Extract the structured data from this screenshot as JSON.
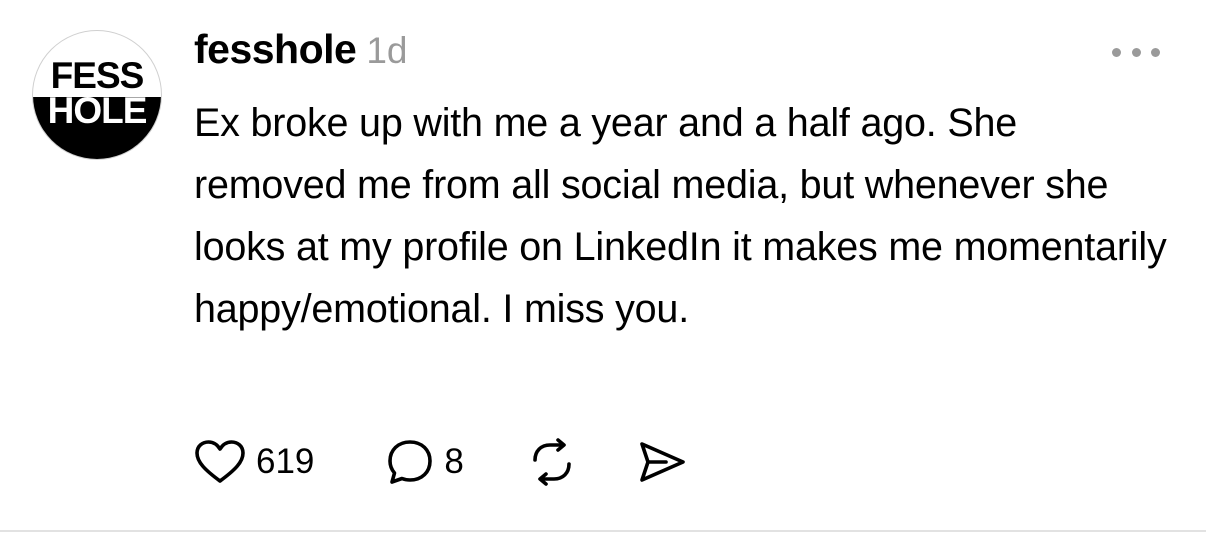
{
  "post": {
    "avatar": {
      "line1": "FESS",
      "line2": "HOLE"
    },
    "username": "fesshole",
    "timestamp": "1d",
    "more_icon": "ellipsis-icon",
    "text": "Ex broke up with me a year and a half ago. She removed me from all social media, but whenever she looks at my profile on LinkedIn it makes me momentarily happy/emotional. I miss you.",
    "actions": {
      "like": {
        "icon": "heart-icon",
        "count": "619"
      },
      "comment": {
        "icon": "comment-bubble-icon",
        "count": "8"
      },
      "repost": {
        "icon": "repost-icon"
      },
      "share": {
        "icon": "send-icon"
      }
    }
  },
  "colors": {
    "text": "#000000",
    "muted": "#9a9a9a",
    "divider": "#e2e2e2",
    "background": "#ffffff"
  }
}
